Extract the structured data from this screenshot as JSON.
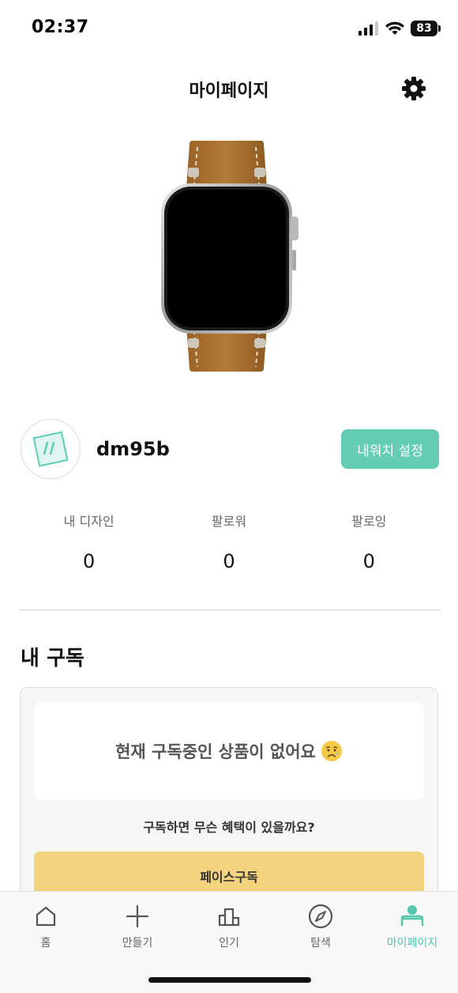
{
  "status_bar": {
    "time": "02:37",
    "battery": "83"
  },
  "header": {
    "title": "마이페이지"
  },
  "profile": {
    "username": "dm95b",
    "my_watch_button": "내워치 설정"
  },
  "stats": [
    {
      "label": "내 디자인",
      "value": "0"
    },
    {
      "label": "팔로워",
      "value": "0"
    },
    {
      "label": "팔로잉",
      "value": "0"
    }
  ],
  "subscription": {
    "title": "내 구독",
    "empty_message": "현재 구독중인 상품이 없어요",
    "benefit_question": "구독하면 무슨 혜택이 있을까요?",
    "face_subscribe_button": "페이스구독"
  },
  "bottom_nav": {
    "items": [
      {
        "label": "홈",
        "icon": "home-icon"
      },
      {
        "label": "만들기",
        "icon": "plus-icon"
      },
      {
        "label": "인기",
        "icon": "ranking-icon"
      },
      {
        "label": "탐색",
        "icon": "compass-icon"
      },
      {
        "label": "마이페이지",
        "icon": "person-icon"
      }
    ],
    "active_index": 4
  },
  "colors": {
    "accent": "#66cdb5",
    "active_nav": "#52c7ad",
    "subscribe_button": "#f4d37e"
  }
}
